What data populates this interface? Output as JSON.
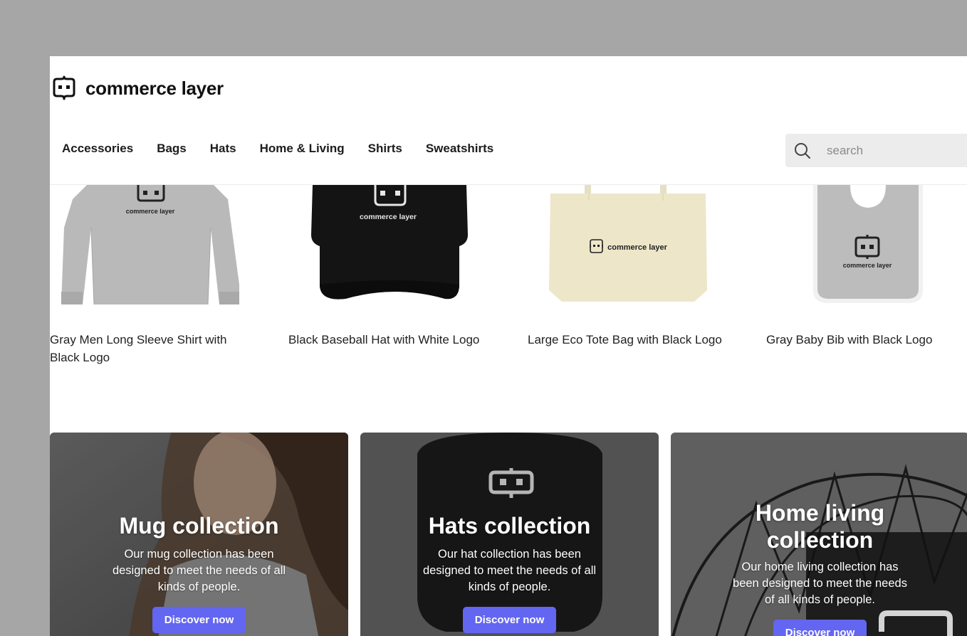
{
  "brand": {
    "name": "commerce layer"
  },
  "nav": {
    "items": [
      "Accessories",
      "Bags",
      "Hats",
      "Home & Living",
      "Shirts",
      "Sweatshirts"
    ]
  },
  "search": {
    "placeholder": "search",
    "icon": "search-icon"
  },
  "products": [
    {
      "name": "Gray Men Long Sleeve Shirt with Black Logo",
      "logo_text": "commerce layer"
    },
    {
      "name": "Black Baseball Hat with White Logo",
      "logo_text": "commerce layer"
    },
    {
      "name": "Large Eco Tote Bag with Black Logo",
      "logo_text": "commerce layer"
    },
    {
      "name": "Gray Baby Bib with Black Logo",
      "logo_text": "commerce layer"
    }
  ],
  "collections": [
    {
      "title": "Mug collection",
      "description": "Our mug collection has been designed to meet the needs of all kinds of people.",
      "button": "Discover now"
    },
    {
      "title": "Hats collection",
      "description": "Our hat collection has been designed to meet the needs of all kinds of people.",
      "button": "Discover now"
    },
    {
      "title": "Home living collection",
      "description": "Our home living collection has been designed to meet the needs of all kinds of people.",
      "button": "Discover now"
    }
  ],
  "colors": {
    "accent": "#6366f1",
    "page_bg": "#a6a6a6",
    "search_bg": "#ececec"
  }
}
